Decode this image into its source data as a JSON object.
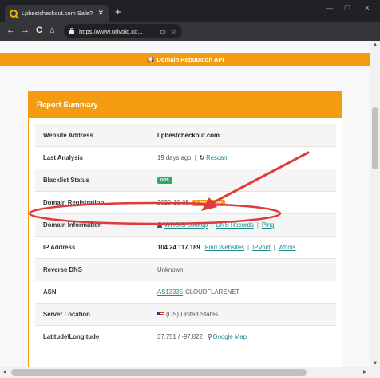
{
  "browser": {
    "tab_title": "Lpbestcheckout.com Safe? Check",
    "tab_close": "✕",
    "new_tab": "+",
    "window_controls": {
      "minimize": "—",
      "maximize": "☐",
      "close": "✕"
    },
    "nav": {
      "back": "←",
      "forward": "→",
      "reload": "C",
      "home": "⌂"
    },
    "url": "https://www.urlvoid.co...",
    "omnibox_icons": {
      "cast": "▭",
      "bookmark": "☆"
    }
  },
  "banner": {
    "icon": "megaphone-icon",
    "glyph": "📢",
    "text": "Domain Reputation API"
  },
  "report": {
    "title": "Report Summary",
    "rows": [
      {
        "label": "Website Address",
        "value": "Lpbestcheckout.com"
      },
      {
        "label": "Last Analysis",
        "value": "19 days ago",
        "sep": "|",
        "rescan_icon": "↻",
        "rescan": "Rescan"
      },
      {
        "label": "Blacklist Status",
        "badge": "0/35"
      },
      {
        "label": "Domain Registration",
        "value": "2020-10-05",
        "badge": "1 month ago"
      },
      {
        "label": "Domain Information",
        "whois": "WHOIS Lookup",
        "sep": "|",
        "dns": "DNS Records",
        "ping": "Ping"
      },
      {
        "label": "IP Address",
        "value": "104.24.117.189",
        "find": "Find Websites",
        "sep": "|",
        "ipvoid": "IPVoid",
        "whois": "Whois"
      },
      {
        "label": "Reverse DNS",
        "value": "Unknown"
      },
      {
        "label": "ASN",
        "asn_link": "AS13335",
        "asn_name": "CLOUDFLARENET"
      },
      {
        "label": "Server Location",
        "value": "(US) United States"
      },
      {
        "label": "Latitude\\Longitude",
        "value": "37.751 / -97.822",
        "map": "Google Map"
      }
    ]
  },
  "scrollbars": {
    "up": "▲",
    "down": "▼",
    "left": "◀",
    "right": "▶"
  },
  "colors": {
    "accent": "#f39c12",
    "annotation": "#e03a3a",
    "link": "#1a8a8a",
    "badge_green": "#27ae60"
  }
}
